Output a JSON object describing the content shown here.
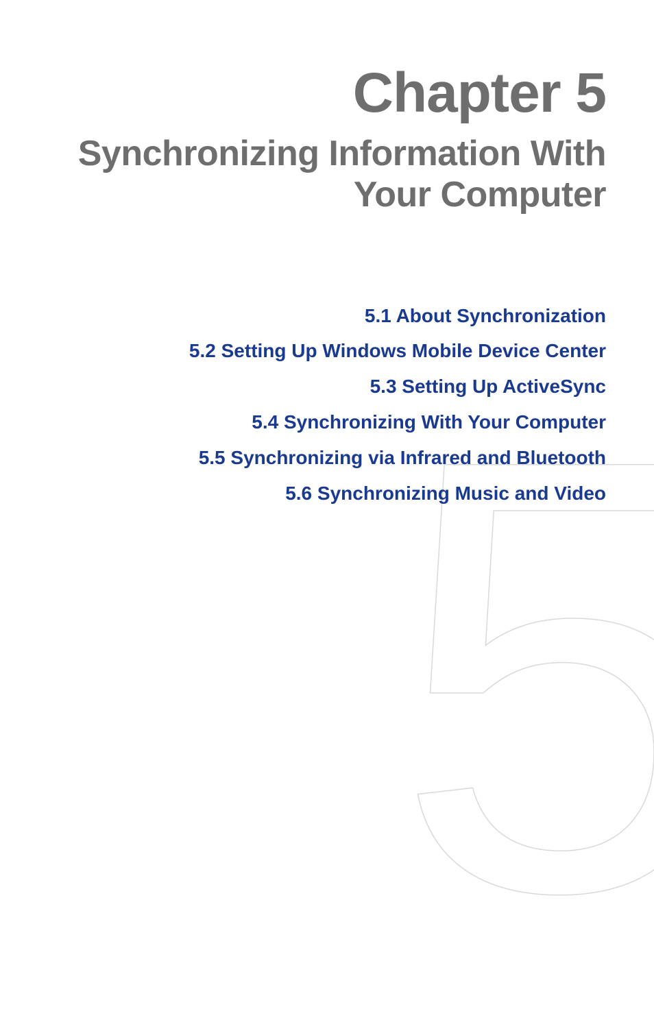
{
  "chapter": {
    "number_label": "Chapter 5",
    "title": "Synchronizing Information With Your Computer",
    "big_numeral": "5"
  },
  "toc": {
    "items": [
      {
        "label": "5.1  About Synchronization"
      },
      {
        "label": "5.2  Setting Up Windows Mobile Device Center"
      },
      {
        "label": "5.3  Setting Up ActiveSync"
      },
      {
        "label": "5.4  Synchronizing With Your Computer"
      },
      {
        "label": "5.5  Synchronizing via Infrared and Bluetooth"
      },
      {
        "label": "5.6  Synchronizing Music and Video"
      }
    ]
  },
  "colors": {
    "heading_gray": "#6e6e6e",
    "link_blue": "#1a3a8f",
    "outline_gray": "#d9d9d9"
  }
}
